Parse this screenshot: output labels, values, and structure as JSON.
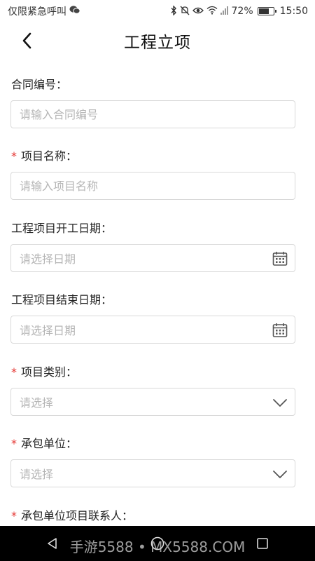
{
  "status_bar": {
    "carrier": "仅限紧急呼叫",
    "battery_percent": "72%",
    "battery_level": 0.72,
    "time": "15:50",
    "icons": [
      "wechat-icon",
      "bluetooth-icon",
      "mute-icon",
      "eye-icon",
      "wifi-icon",
      "signal-icon",
      "battery-icon"
    ]
  },
  "header": {
    "title": "工程立项",
    "back_icon": "chevron-left-icon"
  },
  "form": {
    "fields": [
      {
        "label": "合同编号：",
        "required": false,
        "type": "text",
        "placeholder": "请输入合同编号"
      },
      {
        "label": "项目名称：",
        "required": true,
        "type": "text",
        "placeholder": "请输入项目名称"
      },
      {
        "label": "工程项目开工日期：",
        "required": false,
        "type": "date",
        "placeholder": "请选择日期",
        "icon": "calendar-icon"
      },
      {
        "label": "工程项目结束日期：",
        "required": false,
        "type": "date",
        "placeholder": "请选择日期",
        "icon": "calendar-icon"
      },
      {
        "label": "项目类别：",
        "required": true,
        "type": "select",
        "placeholder": "请选择",
        "icon": "chevron-down-icon"
      },
      {
        "label": "承包单位：",
        "required": true,
        "type": "select",
        "placeholder": "请选择",
        "icon": "chevron-down-icon"
      },
      {
        "label": "承包单位项目联系人：",
        "required": true,
        "type": "text",
        "placeholder": ""
      }
    ],
    "required_mark": "*"
  },
  "nav_bar": {
    "icons": [
      "back-triangle-icon",
      "home-circle-icon",
      "recents-square-icon"
    ]
  },
  "watermark": "手游5588 • MX5588.COM",
  "colors": {
    "required": "#e53935",
    "border": "#d9d9d9",
    "placeholder": "#b5b5b5",
    "nav_bg": "#000000"
  }
}
